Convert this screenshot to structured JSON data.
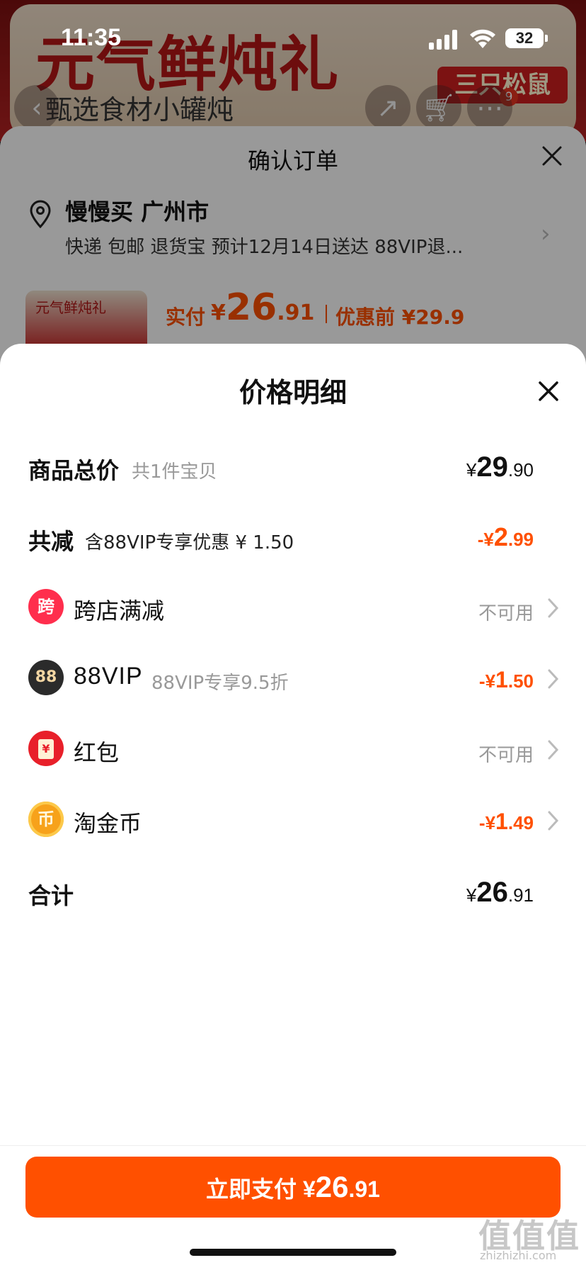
{
  "status_bar": {
    "time": "11:35",
    "battery": "32"
  },
  "background": {
    "banner_title": "元气鲜炖礼",
    "banner_subtitle": "甄选食材小罐炖",
    "brand": "三只松鼠",
    "cart_count": "9"
  },
  "order_sheet": {
    "title": "确认订单",
    "address_name": "慢慢买 广州市",
    "address_detail": "快递 包邮 退货宝 预计12月14日送达 88VIP退...",
    "product_thumb_text": "元气鲜炖礼",
    "paid_label": "实付",
    "paid_currency": "¥",
    "paid_int": "26",
    "paid_dec": ".91",
    "before_label": "优惠前 ¥29.9"
  },
  "price_detail": {
    "title": "价格明细",
    "total": {
      "label": "商品总价",
      "sub": "共1件宝贝",
      "currency": "¥",
      "int": "29",
      "dec": ".90"
    },
    "discount": {
      "label": "共减",
      "sub": "含88VIP专享优惠 ¥ 1.50",
      "prefix": "-¥",
      "int": "2",
      "dec": ".99"
    },
    "cross_store": {
      "icon_char": "跨",
      "label": "跨店满减",
      "value": "不可用"
    },
    "vip": {
      "icon_char": "88",
      "label": "88VIP",
      "sub": "88VIP专享9.5折",
      "prefix": "-¥",
      "int": "1",
      "dec": ".50"
    },
    "red_packet": {
      "icon_char": "¥",
      "label": "红包",
      "value": "不可用"
    },
    "gold_coin": {
      "icon_char": "币",
      "label": "淘金币",
      "prefix": "-¥",
      "int": "1",
      "dec": ".49"
    },
    "sum": {
      "label": "合计",
      "currency": "¥",
      "int": "26",
      "dec": ".91"
    }
  },
  "pay_button": {
    "label": "立即支付 ¥",
    "int": "26",
    "dec": ".91"
  },
  "watermark": {
    "text": "值值值",
    "sub": "zhizhizhi.com"
  },
  "colors": {
    "accent": "#ff5000",
    "cross_store_badge": "#ff2e4d",
    "vip_badge": "#2b2b2b",
    "red_packet_badge": "#e8202a",
    "gold_coin_badge": "#f7a21b"
  }
}
